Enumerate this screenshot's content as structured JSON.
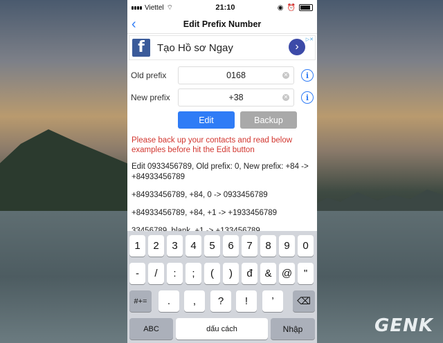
{
  "status": {
    "carrier": "Viettel",
    "time": "21:10"
  },
  "nav": {
    "title": "Edit Prefix Number"
  },
  "ad": {
    "text": "Tạo Hồ sơ Ngay"
  },
  "form": {
    "old_label": "Old prefix",
    "old_value": "0168",
    "new_label": "New prefix",
    "new_value": "+38"
  },
  "buttons": {
    "edit": "Edit",
    "backup": "Backup"
  },
  "warning": "Please back up your contacts and read below examples before hit the Edit button",
  "examples": [
    "Edit 0933456789, Old prefix: 0, New prefix: +84 -> +84933456789",
    "+84933456789, +84, 0 -> 0933456789",
    "+84933456789, +84, +1 -> +1933456789",
    "33456789, blank, +1 -> +133456789"
  ],
  "keyboard": {
    "row1": [
      "1",
      "2",
      "3",
      "4",
      "5",
      "6",
      "7",
      "8",
      "9",
      "0"
    ],
    "row2": [
      "-",
      "/",
      ":",
      ";",
      "(",
      ")",
      "đ",
      "&",
      "@",
      "\""
    ],
    "row3": [
      ".",
      ",",
      "?",
      "!",
      "’"
    ],
    "shift_label": "#+=",
    "abc_label": "ABC",
    "space_label": "dấu cách",
    "return_label": "Nhập"
  },
  "watermark": "GENK"
}
